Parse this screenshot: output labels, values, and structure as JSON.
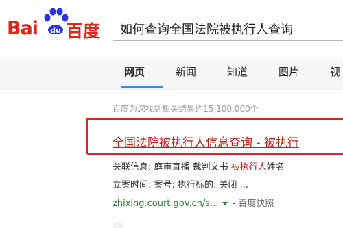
{
  "brand": {
    "logo_left": "Bai",
    "logo_paw": "du",
    "logo_right": "百度",
    "color": "#e1251b",
    "paw_color": "#2932e1"
  },
  "search": {
    "query": "如何查询全国法院被执行人查询"
  },
  "tabs": [
    {
      "label": "网页",
      "active": true
    },
    {
      "label": "新闻",
      "active": false
    },
    {
      "label": "知道",
      "active": false
    },
    {
      "label": "图片",
      "active": false
    },
    {
      "label": "视",
      "active": false
    }
  ],
  "results_info": "百度为您找到相关结果约15,100,000个",
  "result": {
    "title": "全国法院被执行人信息查询 - 被执行",
    "line1_prefix": "关联信息: 庭审直播 裁判文书 ",
    "line1_em": "被执行人",
    "line1_suffix": "姓名",
    "line2": "立案时间: 案号: 执行标的: 关闭 ...",
    "url": "zhixing.court.gov.cn/s...",
    "url_sep": "-",
    "snapshot": "百度快照"
  },
  "colors": {
    "accent": "#3388ff",
    "title_red": "#c0211a",
    "annotation_red": "#e02020",
    "url_green": "#2e7d32"
  }
}
